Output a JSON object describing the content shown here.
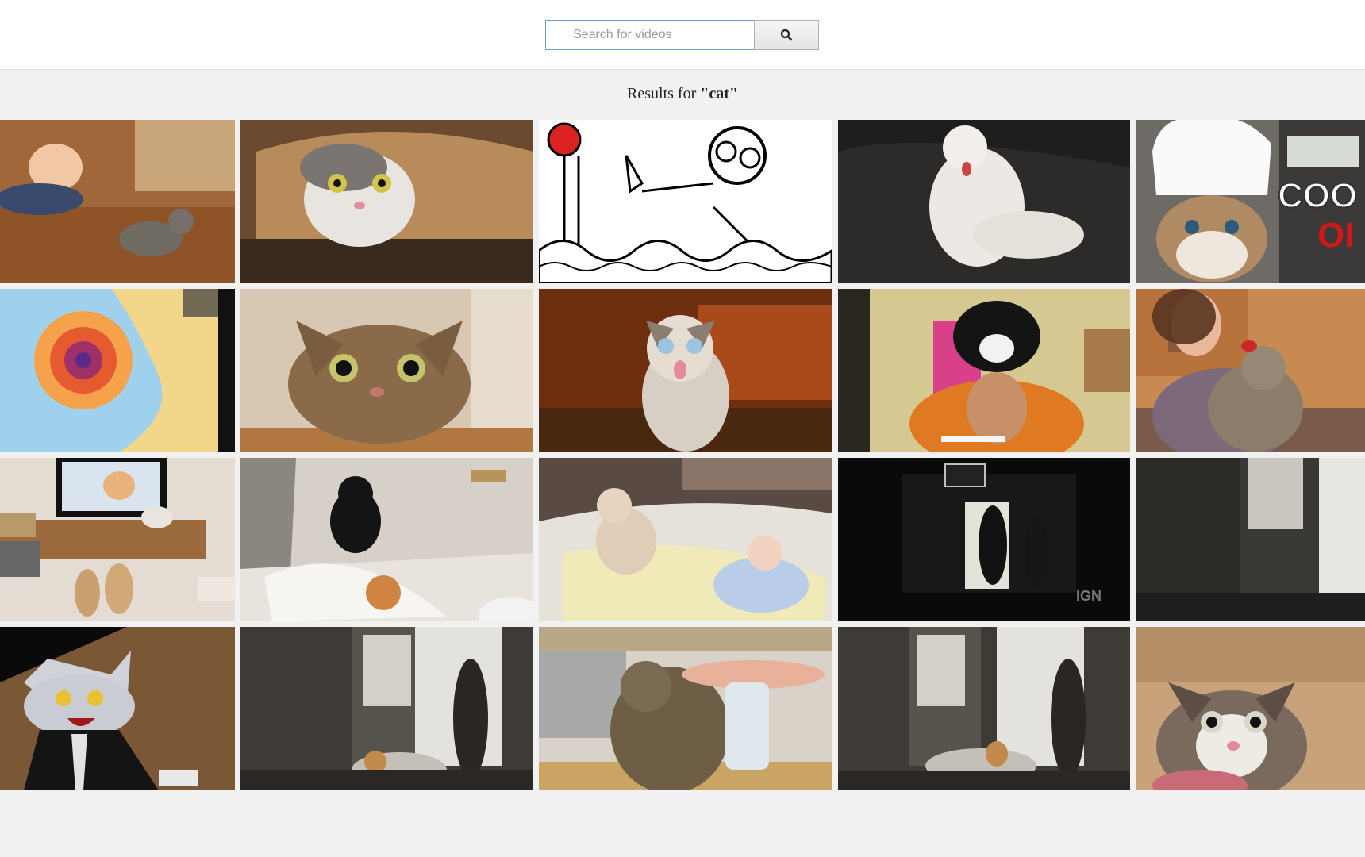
{
  "search": {
    "placeholder": "Search for videos",
    "button_icon": "search-icon"
  },
  "results": {
    "prefix": "Results for ",
    "query_display": "\"cat\""
  },
  "thumbnails": [
    {
      "subject": "baby and kitten on floor"
    },
    {
      "subject": "cat peeking from paper roll"
    },
    {
      "subject": "cartoon cat with butterfly"
    },
    {
      "subject": "white cat on leather couch"
    },
    {
      "subject": "grumpy cat in chef hat",
      "overlay_text": "COO\nOI"
    },
    {
      "subject": "weather radar map"
    },
    {
      "subject": "tabby cat peeking over table"
    },
    {
      "subject": "surprised fluffy kitten"
    },
    {
      "subject": "cat on person's head"
    },
    {
      "subject": "woman hugging cat"
    },
    {
      "subject": "shiba dogs watching tv"
    },
    {
      "subject": "cats with toilet paper"
    },
    {
      "subject": "siamese cat and baby"
    },
    {
      "subject": "dark scene at hideout",
      "overlay_text": "IGN"
    },
    {
      "subject": "doorway with snow"
    },
    {
      "subject": "cartoon cat screaming"
    },
    {
      "subject": "woman at snowy doorway"
    },
    {
      "subject": "cat attacking bottle"
    },
    {
      "subject": "woman at snowy doorway with cat"
    },
    {
      "subject": "surprised cat close-up"
    }
  ]
}
